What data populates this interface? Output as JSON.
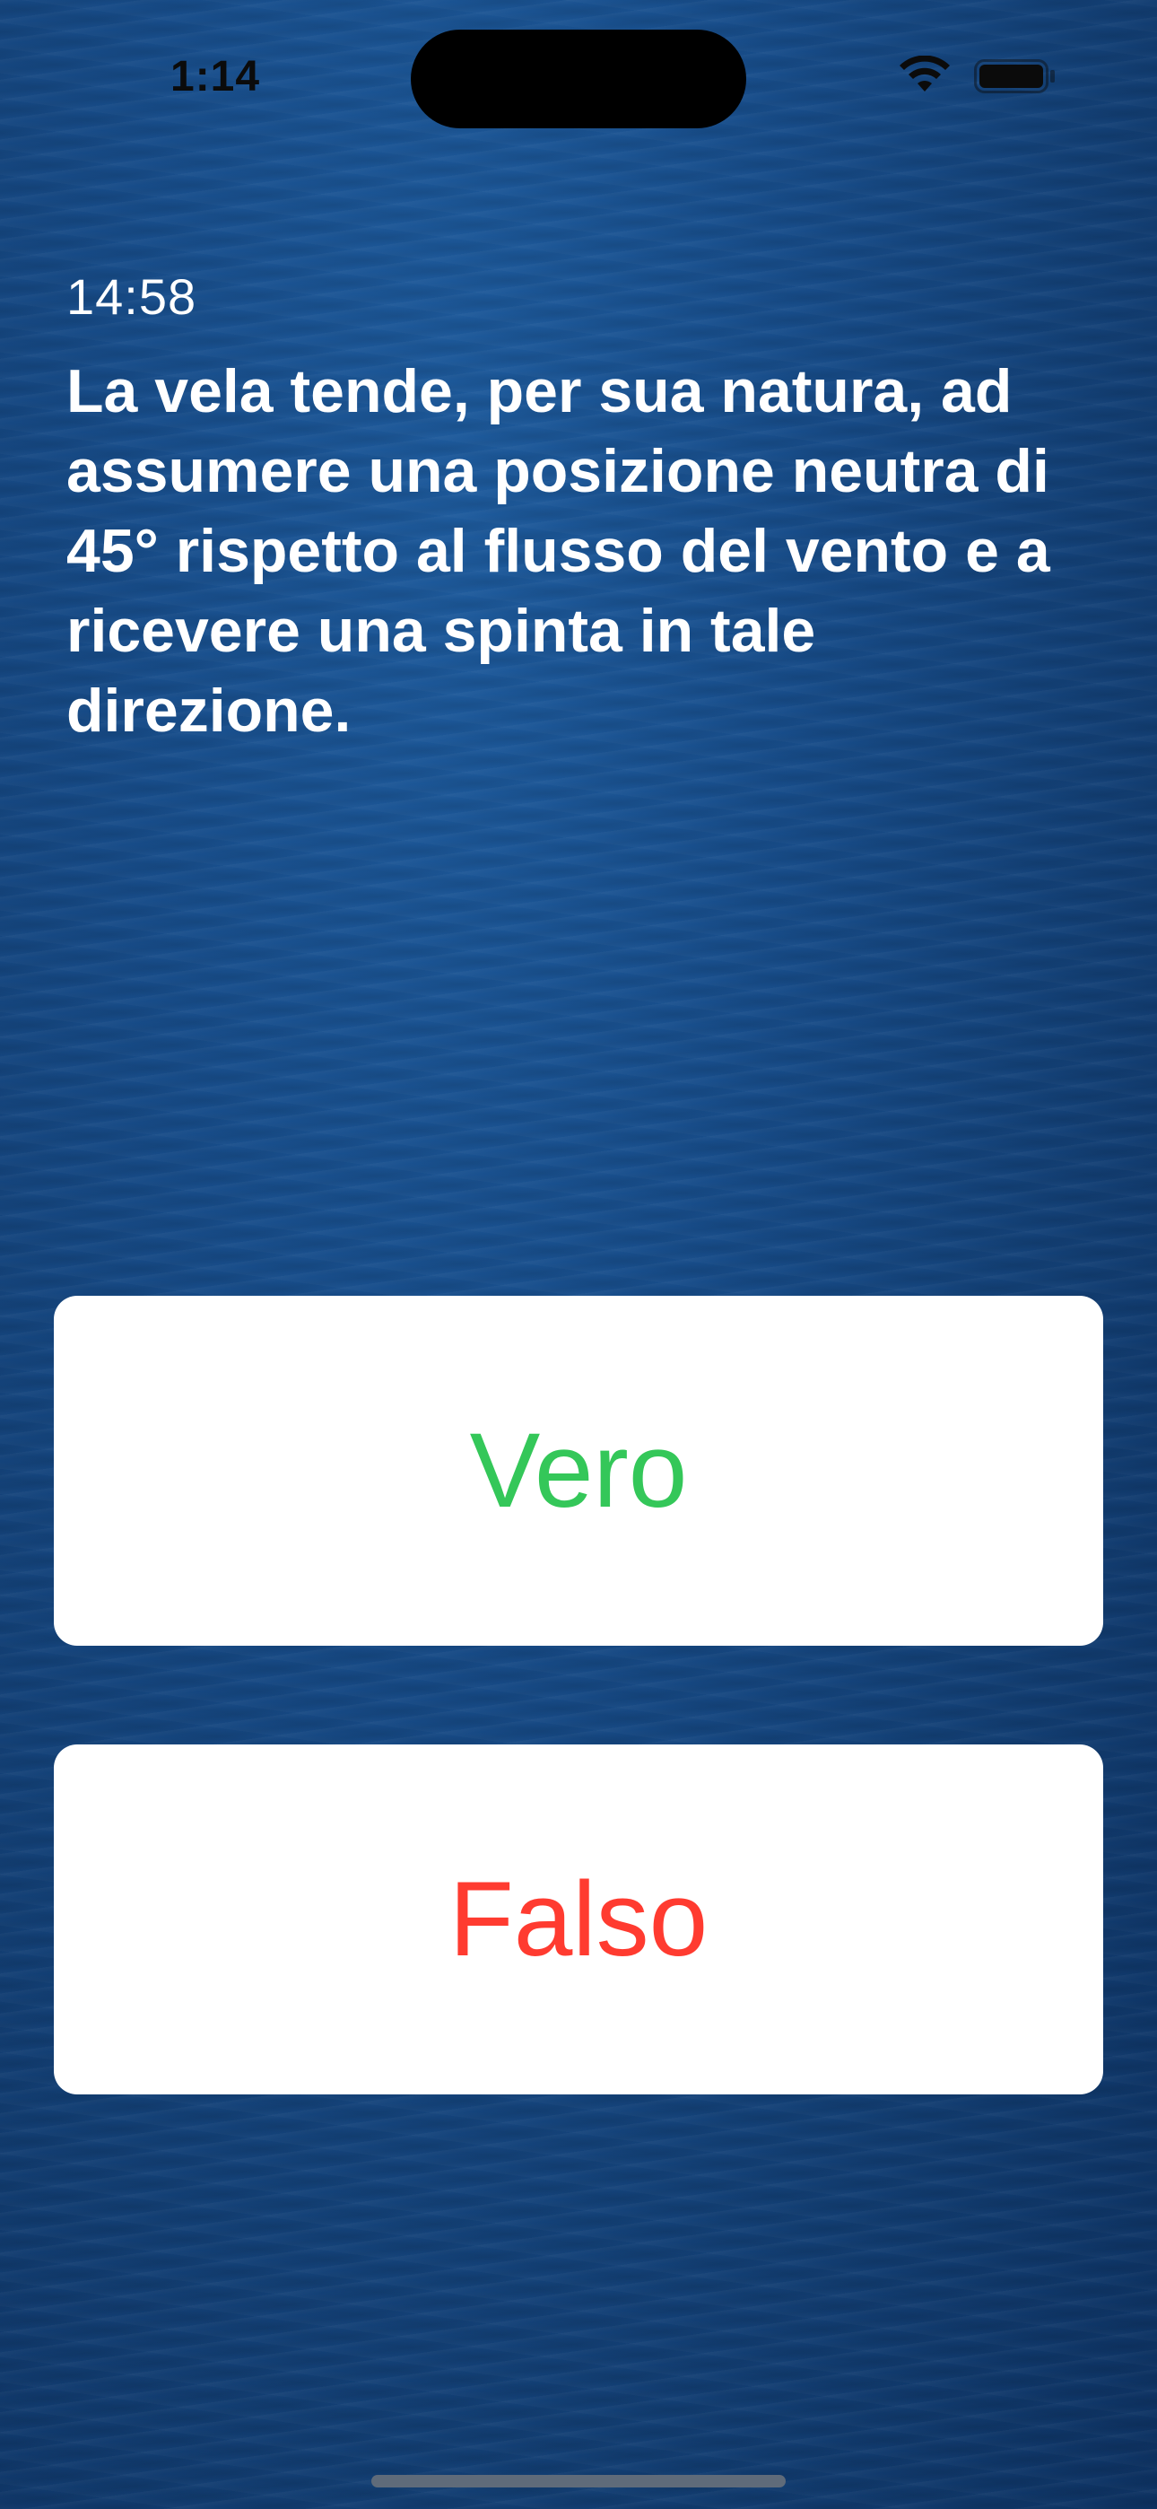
{
  "status_bar": {
    "time": "1:14",
    "icons": [
      "wifi-icon",
      "battery-icon"
    ]
  },
  "quiz": {
    "timer": "14:58",
    "question": "La vela tende, per sua natura, ad assumere una posizione neutra di 45° rispetto al flusso del vento e a ricevere una spinta in tale direzione."
  },
  "answers": {
    "true_label": "Vero",
    "false_label": "Falso"
  },
  "colors": {
    "true": "#34C759",
    "false": "#FF3B30",
    "background": "#174c89"
  }
}
